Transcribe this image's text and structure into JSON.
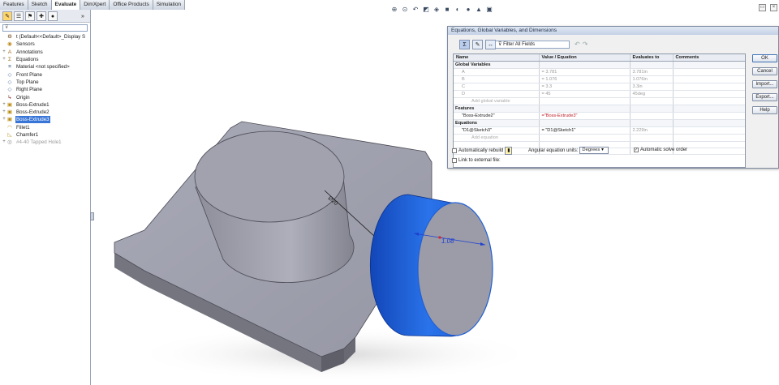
{
  "tabs": [
    {
      "label": "Features"
    },
    {
      "label": "Sketch"
    },
    {
      "label": "Evaluate"
    },
    {
      "label": "DimXpert"
    },
    {
      "label": "Office Products"
    },
    {
      "label": "Simulation"
    }
  ],
  "active_tab": "Evaluate",
  "tree": {
    "filter_placeholder": "",
    "items": [
      {
        "label": "t (Default<<Default>_Display S",
        "icon": "part-icon",
        "expand": "",
        "selected": false,
        "suppressed": false
      },
      {
        "label": "Sensors",
        "icon": "sensor-icon",
        "expand": "",
        "selected": false,
        "suppressed": false
      },
      {
        "label": "Annotations",
        "icon": "annotation-icon",
        "expand": "+",
        "selected": false,
        "suppressed": false
      },
      {
        "label": "Equations",
        "icon": "equation-icon",
        "expand": "+",
        "selected": false,
        "suppressed": false
      },
      {
        "label": "Material <not specified>",
        "icon": "material-icon",
        "expand": "",
        "selected": false,
        "suppressed": false
      },
      {
        "label": "Front Plane",
        "icon": "plane-icon",
        "expand": "",
        "selected": false,
        "suppressed": false
      },
      {
        "label": "Top Plane",
        "icon": "plane-icon",
        "expand": "",
        "selected": false,
        "suppressed": false
      },
      {
        "label": "Right Plane",
        "icon": "plane-icon",
        "expand": "",
        "selected": false,
        "suppressed": false
      },
      {
        "label": "Origin",
        "icon": "origin-icon",
        "expand": "",
        "selected": false,
        "suppressed": false
      },
      {
        "label": "Boss-Extrude1",
        "icon": "extrude-icon",
        "expand": "+",
        "selected": false,
        "suppressed": false
      },
      {
        "label": "Boss-Extrude2",
        "icon": "extrude-icon",
        "expand": "+",
        "selected": false,
        "suppressed": false
      },
      {
        "label": "Boss-Extrude3",
        "icon": "extrude-icon",
        "expand": "+",
        "selected": true,
        "suppressed": false
      },
      {
        "label": "Fillet1",
        "icon": "fillet-icon",
        "expand": "",
        "selected": false,
        "suppressed": false
      },
      {
        "label": "Chamfer1",
        "icon": "chamfer-icon",
        "expand": "",
        "selected": false,
        "suppressed": false
      },
      {
        "label": "#4-40 Tapped Hole1",
        "icon": "hole-icon",
        "expand": "+",
        "selected": false,
        "suppressed": true
      }
    ]
  },
  "dialog": {
    "title": "Equations, Global Variables, and Dimensions",
    "filter_label": "Filter All Fields",
    "columns": [
      "Name",
      "Value / Equation",
      "Evaluates to",
      "Comments"
    ],
    "rows": [
      {
        "kind": "section",
        "name": "Global Variables",
        "value": "",
        "eval": "",
        "comment": ""
      },
      {
        "kind": "row",
        "name": "A",
        "value": "= 3.781",
        "eval": "3.781in",
        "comment": ""
      },
      {
        "kind": "row",
        "name": "B",
        "value": "= 1.076",
        "eval": "1.076in",
        "comment": ""
      },
      {
        "kind": "row",
        "name": "C",
        "value": "= 3.3",
        "eval": "3.3in",
        "comment": ""
      },
      {
        "kind": "row",
        "name": "D",
        "value": "= 45",
        "eval": "45deg",
        "comment": ""
      },
      {
        "kind": "hint",
        "name": "Add global variable",
        "value": "",
        "eval": "",
        "comment": ""
      },
      {
        "kind": "section",
        "name": "Features",
        "value": "",
        "eval": "",
        "comment": ""
      },
      {
        "kind": "row",
        "name": "\"Boss-Extrude2\"",
        "value": "=\"Boss-Extrude3\"",
        "eval": "",
        "comment": "",
        "red": true
      },
      {
        "kind": "section",
        "name": "Equations",
        "value": "",
        "eval": "",
        "comment": ""
      },
      {
        "kind": "row",
        "name": "\"D1@Sketch3\"",
        "value": "= \"D1@Sketch1\"",
        "eval": "2.229in",
        "comment": ""
      },
      {
        "kind": "hint",
        "name": "Add equation",
        "value": "",
        "eval": "",
        "comment": ""
      },
      {
        "kind": "blank",
        "name": "",
        "value": "",
        "eval": "",
        "comment": ""
      },
      {
        "kind": "blank",
        "name": "",
        "value": "",
        "eval": "",
        "comment": ""
      }
    ],
    "buttons": {
      "ok": "OK",
      "cancel": "Cancel",
      "import": "Import...",
      "export": "Export...",
      "help": "Help"
    },
    "auto_rebuild_label": "Automatically rebuild",
    "angular_units_label": "Angular equation units:",
    "angular_units_value": "Degrees",
    "auto_solve_label": "Automatic solve order",
    "link_external_label": "Link to external file:"
  },
  "model": {
    "dimension_text": "1.08",
    "face_label": "Ø20",
    "accent_color": "#1f5fd8"
  }
}
